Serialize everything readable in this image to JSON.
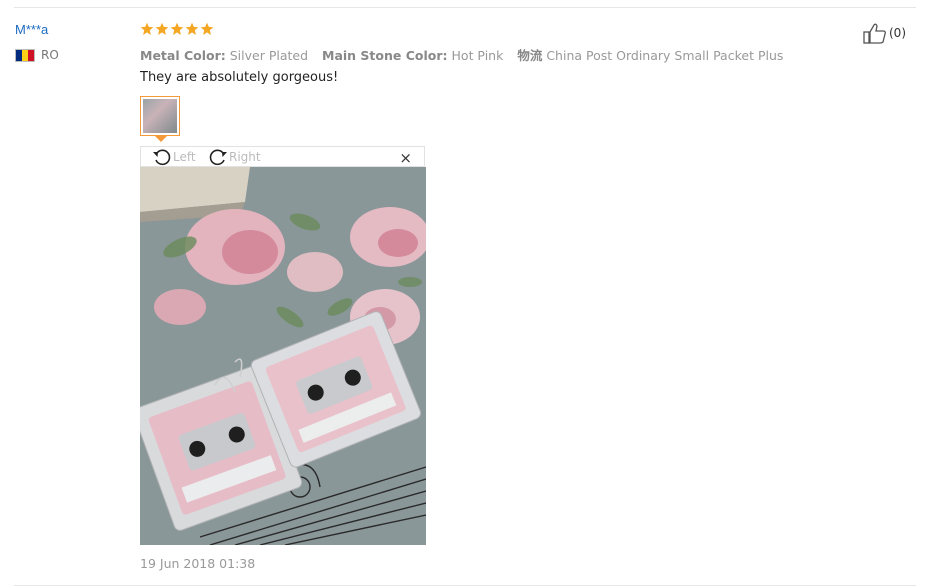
{
  "reviewer": {
    "name": "M***a",
    "country": "RO",
    "flag_colors": [
      "#002b7f",
      "#fcd116",
      "#ce1126"
    ]
  },
  "rating": {
    "stars": 5,
    "max": 5,
    "color": "#f5a623"
  },
  "attributes": [
    {
      "label": "Metal Color:",
      "value": "Silver Plated"
    },
    {
      "label": "Main Stone Color:",
      "value": "Hot Pink"
    },
    {
      "label": "物流",
      "value": "China Post Ordinary Small Packet Plus"
    }
  ],
  "review_text": "They are absolutely gorgeous!",
  "image_viewer": {
    "rotate_left_label": "Left",
    "rotate_right_label": "Right",
    "close_glyph": "×",
    "photo_alt": "Review photo"
  },
  "date": "19 Jun 2018 01:38",
  "helpful": {
    "count": "(0)",
    "icon": "thumbs-up-icon"
  }
}
